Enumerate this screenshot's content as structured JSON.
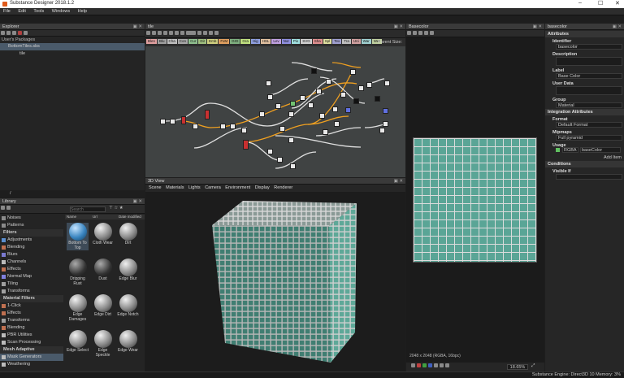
{
  "app": {
    "title": "Substance Designer 2018.1.2"
  },
  "menu": [
    "File",
    "Edit",
    "Tools",
    "Windows",
    "Help"
  ],
  "explorer": {
    "title": "Explorer",
    "packages_label": "User's Packages",
    "package": "BottomTiles.sbs",
    "graph": "tile",
    "path_indicator": "/"
  },
  "graph": {
    "title": "tile",
    "parent_size": "Parent Size:",
    "filters": [
      "Blen",
      "Blu",
      "Cha",
      "Con",
      "Cur",
      "Dir",
      "Emb",
      "FxM",
      "GrD",
      "Gra",
      "Hig",
      "HSL",
      "Lev",
      "Nor",
      "Pix",
      "SVG",
      "Sha",
      "Spl",
      "Tex",
      "Tra",
      "Uni",
      "War",
      "Wer"
    ]
  },
  "view3d": {
    "title": "3D View",
    "menu": [
      "Scene",
      "Materials",
      "Lights",
      "Camera",
      "Environment",
      "Display",
      "Renderer"
    ]
  },
  "view2d": {
    "title": "Basecolor",
    "info": "2048 x 2048 (RGBA, 16bpc)",
    "zoom": "18.65%"
  },
  "props": {
    "title": "basecolor",
    "attributes_title": "Attributes",
    "identifier_label": "Identifier",
    "identifier_value": "basecolor",
    "description_label": "Description",
    "label_label": "Label",
    "label_value": "Base Color",
    "userdata_label": "User Data",
    "group_label": "Group",
    "group_value": "Material",
    "integration_title": "Integration Attributes",
    "format_label": "Format",
    "format_value": "Default Format",
    "mipmaps_label": "Mipmaps",
    "mipmaps_value": "Full pyramid",
    "usage_label": "Usage",
    "usage_channel": "RGBA",
    "usage_value": "baseColor",
    "add_item": "Add Item",
    "conditions_title": "Conditions",
    "visibleif_label": "Visible If"
  },
  "library": {
    "title": "Library",
    "search_placeholder": "Search",
    "col_name": "Name",
    "col_url": "Url",
    "col_modified": "Date modified",
    "tree": [
      {
        "label": "Noises",
        "type": "item",
        "color": "#8a8a8a"
      },
      {
        "label": "Patterns",
        "type": "item",
        "color": "#8a8a8a"
      },
      {
        "label": "Filters",
        "type": "hdr"
      },
      {
        "label": "Adjustments",
        "type": "item",
        "color": "#5b8fd0"
      },
      {
        "label": "Blending",
        "type": "item",
        "color": "#c07050"
      },
      {
        "label": "Blurs",
        "type": "item",
        "color": "#7a7ad0"
      },
      {
        "label": "Channels",
        "type": "item",
        "color": "#bbbbbb"
      },
      {
        "label": "Effects",
        "type": "item",
        "color": "#c07050"
      },
      {
        "label": "Normal Map",
        "type": "item",
        "color": "#8080e0"
      },
      {
        "label": "Tiling",
        "type": "item",
        "color": "#a0a0a0"
      },
      {
        "label": "Transforms",
        "type": "item",
        "color": "#a0a0a0"
      },
      {
        "label": "Material Filters",
        "type": "hdr"
      },
      {
        "label": "1-Click",
        "type": "item",
        "color": "#c07050"
      },
      {
        "label": "Effects",
        "type": "item",
        "color": "#c07050"
      },
      {
        "label": "Transforms",
        "type": "item",
        "color": "#a0a0a0"
      },
      {
        "label": "Blending",
        "type": "item",
        "color": "#c07050"
      },
      {
        "label": "PBR Utilities",
        "type": "item",
        "color": "#bbbbbb"
      },
      {
        "label": "Scan Processing",
        "type": "item",
        "color": "#bbbbbb"
      },
      {
        "label": "Mesh Adaptive",
        "type": "hdr"
      },
      {
        "label": "Mask Generators",
        "type": "sel",
        "color": "#bbbbbb"
      },
      {
        "label": "Weathering",
        "type": "item",
        "color": "#bbbbbb"
      }
    ],
    "thumbs": [
      "Bottom To Top",
      "Cloth Wear",
      "Dirt",
      "Dripping Rust",
      "Dust",
      "Edge Blur",
      "Edge Damages",
      "Edge Dirt",
      "Edge Notch",
      "Edge Select",
      "Edge Speckle",
      "Edge Wear"
    ]
  },
  "status": {
    "engine": "Substance Engine: Direct3D 10  Memory: 3%"
  }
}
